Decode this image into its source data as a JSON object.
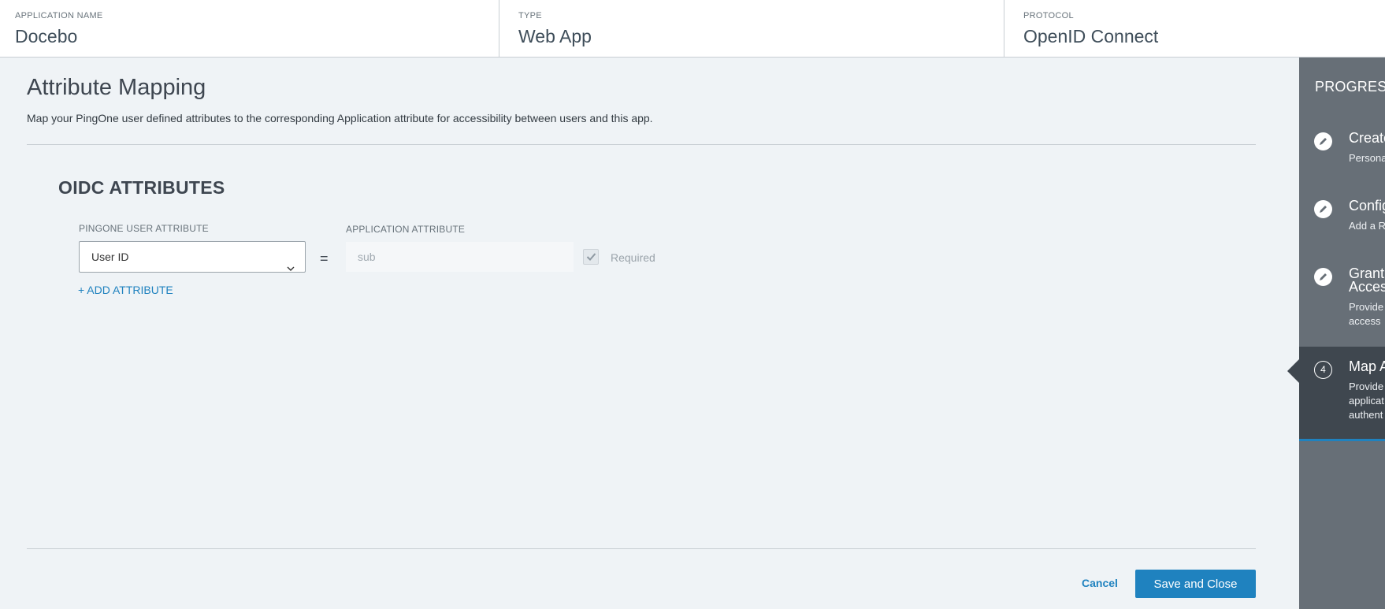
{
  "header": {
    "app_name_label": "APPLICATION NAME",
    "app_name_value": "Docebo",
    "type_label": "TYPE",
    "type_value": "Web App",
    "protocol_label": "PROTOCOL",
    "protocol_value": "OpenID Connect"
  },
  "main": {
    "title": "Attribute Mapping",
    "description": "Map your PingOne user defined attributes to the corresponding Application attribute for accessibility between users and this app.",
    "section_title": "OIDC ATTRIBUTES",
    "pingone_col_label": "PINGONE USER ATTRIBUTE",
    "app_col_label": "APPLICATION ATTRIBUTE",
    "mapping": {
      "pingone_attribute": "User ID",
      "equals": "=",
      "application_attribute": "sub",
      "required_label": "Required",
      "required_checked": true
    },
    "add_attribute": "+ ADD ATTRIBUTE",
    "cancel": "Cancel",
    "save": "Save and Close"
  },
  "sidebar": {
    "title": "PROGRESS",
    "steps": [
      {
        "title": "Create",
        "desc": "Persona",
        "icon": "pencil-icon"
      },
      {
        "title": "Config",
        "desc": "Add a R",
        "icon": "pencil-icon"
      },
      {
        "title": "Grant",
        "title2": "Acces",
        "desc": "Provide",
        "desc2": "access",
        "icon": "pencil-icon"
      },
      {
        "number": "4",
        "title": "Map A",
        "desc": "Provide",
        "desc2": "applicat",
        "desc3": "authent"
      }
    ]
  },
  "colors": {
    "accent": "#1f82bf",
    "sidebar_bg": "#676f77",
    "sidebar_active_bg": "#3f474f",
    "page_bg": "#eff3f6"
  }
}
